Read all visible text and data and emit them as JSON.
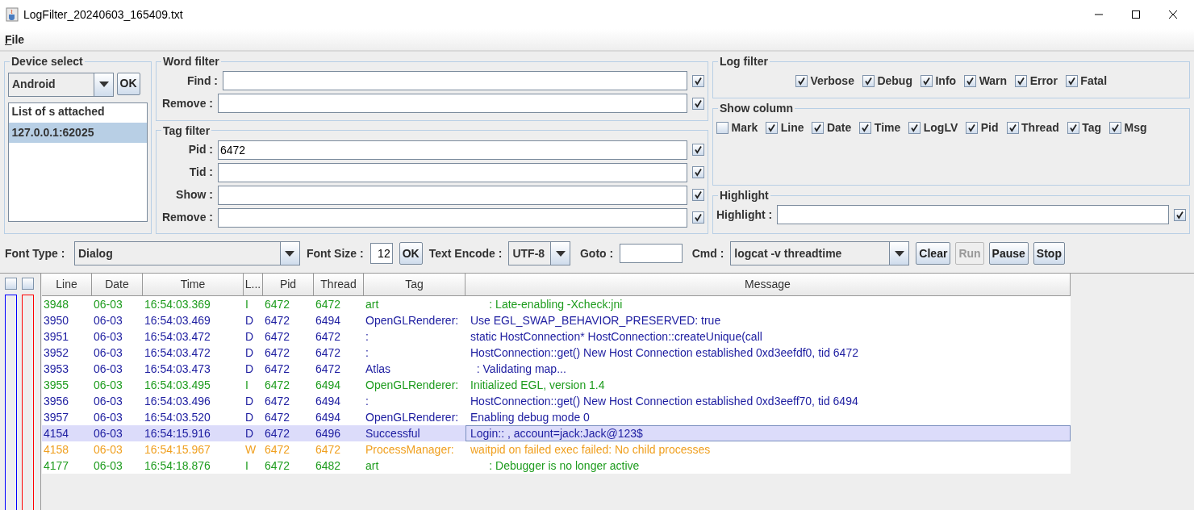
{
  "window": {
    "title": "LogFilter_20240603_165409.txt"
  },
  "menu": [
    "File"
  ],
  "device_select": {
    "title": "Device select",
    "device": "Android",
    "ok": "OK",
    "list_header": "List of s attached",
    "devices": [
      {
        "label": "127.0.0.1:62025",
        "selected": true
      }
    ]
  },
  "word_filter": {
    "title": "Word filter",
    "fields": [
      {
        "label": "Find :",
        "checked": true
      },
      {
        "label": "Remove :",
        "checked": true
      }
    ]
  },
  "tag_filter": {
    "title": "Tag filter",
    "fields": [
      {
        "label": "Pid :",
        "value": "6472",
        "checked": true
      },
      {
        "label": "Tid :",
        "checked": true
      },
      {
        "label": "Show :",
        "checked": true
      },
      {
        "label": "Remove :",
        "checked": true
      }
    ]
  },
  "log_filter": {
    "title": "Log filter",
    "options": [
      {
        "label": "Verbose",
        "checked": true
      },
      {
        "label": "Debug",
        "checked": true
      },
      {
        "label": "Info",
        "checked": true
      },
      {
        "label": "Warn",
        "checked": true
      },
      {
        "label": "Error",
        "checked": true
      },
      {
        "label": "Fatal",
        "checked": true
      }
    ]
  },
  "show_column": {
    "title": "Show column",
    "options": [
      {
        "label": "Mark",
        "checked": false
      },
      {
        "label": "Line",
        "checked": true
      },
      {
        "label": "Date",
        "checked": true
      },
      {
        "label": "Time",
        "checked": true
      },
      {
        "label": "LogLV",
        "checked": true
      },
      {
        "label": "Pid",
        "checked": true
      },
      {
        "label": "Thread",
        "checked": true
      },
      {
        "label": "Tag",
        "checked": true
      },
      {
        "label": "Msg",
        "checked": true
      }
    ]
  },
  "highlight": {
    "title": "Highlight",
    "label": "Highlight :",
    "checked": true
  },
  "toolbar": {
    "font_type_label": "Font Type :",
    "font_type": "Dialog",
    "font_size_label": "Font Size :",
    "font_size": "12",
    "ok": "OK",
    "encode_label": "Text Encode :",
    "encode": "UTF-8",
    "goto_label": "Goto :",
    "cmd_label": "Cmd :",
    "cmd": "logcat -v threadtime",
    "buttons": [
      {
        "label": "Clear",
        "disabled": false
      },
      {
        "label": "Run",
        "disabled": true
      },
      {
        "label": "Pause",
        "disabled": false
      },
      {
        "label": "Stop",
        "disabled": false
      }
    ]
  },
  "mark_columns": [
    {
      "checked": false
    },
    {
      "checked": false
    }
  ],
  "table": {
    "columns": [
      "Line",
      "Date",
      "Time",
      "L...",
      "Pid",
      "Thread",
      "Tag",
      "Message"
    ],
    "rows": [
      {
        "kind": "info",
        "line": "3948",
        "date": "06-03",
        "time": "16:54:03.369",
        "level": "I",
        "pid": "6472",
        "thread": "6472",
        "tag": "art",
        "message": "      : Late-enabling -Xcheck:jni",
        "selected": false
      },
      {
        "kind": "debug",
        "line": "3950",
        "date": "06-03",
        "time": "16:54:03.469",
        "level": "D",
        "pid": "6472",
        "thread": "6494",
        "tag": "OpenGLRenderer:",
        "message": "Use EGL_SWAP_BEHAVIOR_PRESERVED: true",
        "selected": false
      },
      {
        "kind": "debug",
        "line": "3951",
        "date": "06-03",
        "time": "16:54:03.472",
        "level": "D",
        "pid": "6472",
        "thread": "6472",
        "tag": ":",
        "message": "static HostConnection* HostConnection::createUnique(call",
        "selected": false
      },
      {
        "kind": "debug",
        "line": "3952",
        "date": "06-03",
        "time": "16:54:03.472",
        "level": "D",
        "pid": "6472",
        "thread": "6472",
        "tag": ":",
        "message": "HostConnection::get() New Host Connection established 0xd3eefdf0, tid 6472",
        "selected": false
      },
      {
        "kind": "debug",
        "line": "3953",
        "date": "06-03",
        "time": "16:54:03.473",
        "level": "D",
        "pid": "6472",
        "thread": "6472",
        "tag": "Atlas",
        "message": "  : Validating map...",
        "selected": false
      },
      {
        "kind": "info",
        "line": "3955",
        "date": "06-03",
        "time": "16:54:03.495",
        "level": "I",
        "pid": "6472",
        "thread": "6494",
        "tag": "OpenGLRenderer:",
        "message": "Initialized EGL, version 1.4",
        "selected": false
      },
      {
        "kind": "debug",
        "line": "3956",
        "date": "06-03",
        "time": "16:54:03.496",
        "level": "D",
        "pid": "6472",
        "thread": "6494",
        "tag": ":",
        "message": "HostConnection::get() New Host Connection established 0xd3eeff70, tid 6494",
        "selected": false
      },
      {
        "kind": "debug",
        "line": "3957",
        "date": "06-03",
        "time": "16:54:03.520",
        "level": "D",
        "pid": "6472",
        "thread": "6494",
        "tag": "OpenGLRenderer:",
        "message": "Enabling debug mode 0",
        "selected": false
      },
      {
        "kind": "debug",
        "line": "4154",
        "date": "06-03",
        "time": "16:54:15.916",
        "level": "D",
        "pid": "6472",
        "thread": "6496",
        "tag": "Successful",
        "message": "Login:: , account=jack:Jack@123$",
        "selected": true
      },
      {
        "kind": "warn",
        "line": "4158",
        "date": "06-03",
        "time": "16:54:15.967",
        "level": "W",
        "pid": "6472",
        "thread": "6472",
        "tag": "ProcessManager:",
        "message": "waitpid on failed exec failed: No child processes",
        "selected": false
      },
      {
        "kind": "info",
        "line": "4177",
        "date": "06-03",
        "time": "16:54:18.876",
        "level": "I",
        "pid": "6472",
        "thread": "6482",
        "tag": "art",
        "message": "      : Debugger is no longer active",
        "selected": false
      }
    ]
  }
}
